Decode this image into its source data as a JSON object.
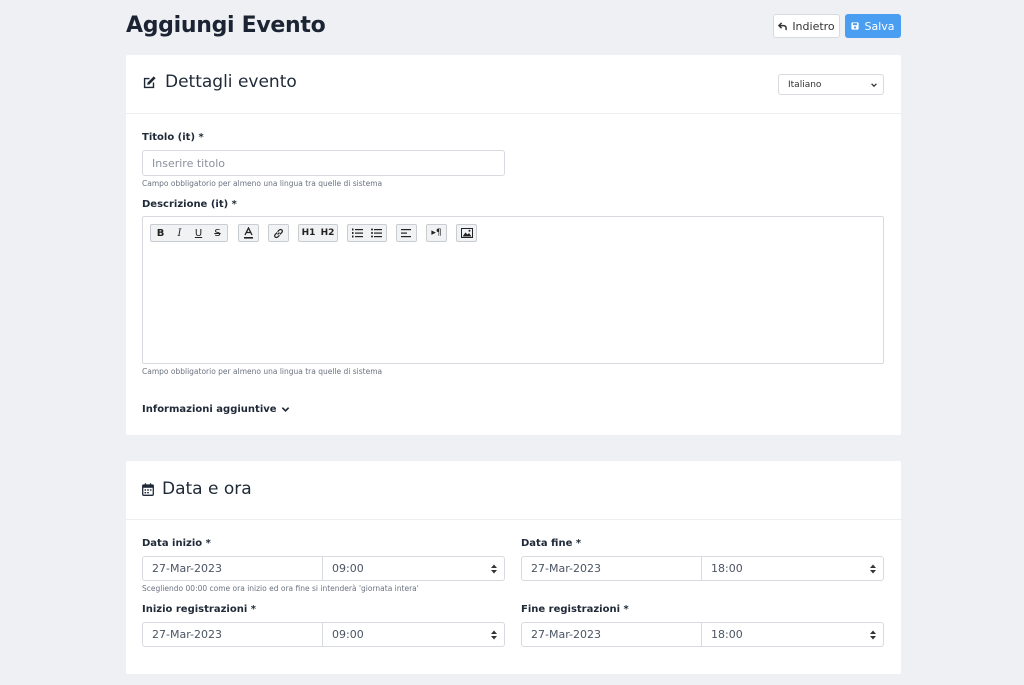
{
  "header": {
    "title": "Aggiungi Evento",
    "back_label": "Indietro",
    "save_label": "Salva"
  },
  "details": {
    "title": "Dettagli evento",
    "language": "Italiano",
    "title_label": "Titolo (it) *",
    "title_placeholder": "Inserire titolo",
    "title_value": "",
    "title_help": "Campo obbligatorio per almeno una lingua tra quelle di sistema",
    "description_label": "Descrizione (it) *",
    "description_help": "Campo obbligatorio per almeno una lingua tra quelle di sistema",
    "toolbar": {
      "bold": "B",
      "italic": "I",
      "underline": "U",
      "strike": "S",
      "h1": "H1",
      "h2": "H2"
    },
    "more_info": "Informazioni aggiuntive"
  },
  "datetime": {
    "title": "Data e ora",
    "start": {
      "label": "Data inizio *",
      "date": "27-Mar-2023",
      "time": "09:00"
    },
    "start_help": "Scegliendo 00:00 come ora inizio ed ora fine si intenderà 'giornata intera'",
    "end": {
      "label": "Data fine *",
      "date": "27-Mar-2023",
      "time": "18:00"
    },
    "reg_start": {
      "label": "Inizio registrazioni *",
      "date": "27-Mar-2023",
      "time": "09:00"
    },
    "reg_end": {
      "label": "Fine registrazioni *",
      "date": "27-Mar-2023",
      "time": "18:00"
    }
  },
  "colors": {
    "primary": "#4a9ef2",
    "background": "#eef0f3"
  },
  "icons": [
    "undo-icon",
    "save-icon",
    "edit-icon",
    "chevron-down-icon",
    "calendar-icon"
  ]
}
